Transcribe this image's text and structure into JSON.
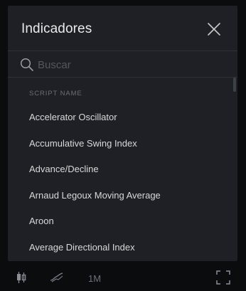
{
  "dialog": {
    "title": "Indicadores",
    "close_icon": "close-icon"
  },
  "search": {
    "icon": "search-icon",
    "placeholder": "Buscar",
    "value": ""
  },
  "list": {
    "column_header": "SCRIPT NAME",
    "items": [
      "Accelerator Oscillator",
      "Accumulative Swing Index",
      "Advance/Decline",
      "Arnaud Legoux Moving Average",
      "Aroon",
      "Average Directional Index"
    ]
  },
  "toolbar": {
    "candles_icon": "candlestick-icon",
    "indicators_icon": "indicators-icon",
    "interval": "1M",
    "fullscreen_icon": "fullscreen-icon"
  },
  "colors": {
    "dialog_background": "#1e2025",
    "page_background": "#0b0c0e",
    "text_primary": "#d8d9dc",
    "text_muted": "#6b6e74"
  }
}
